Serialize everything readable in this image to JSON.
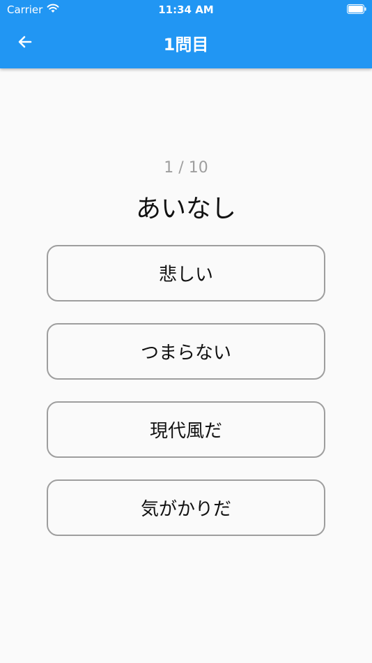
{
  "status_bar": {
    "carrier": "Carrier",
    "time": "11:34 AM"
  },
  "header": {
    "title": "1問目",
    "back_icon": "arrow-left-icon",
    "background_color": "#2196f3"
  },
  "quiz": {
    "counter": "1 / 10",
    "question": "あいなし",
    "answers": [
      {
        "label": "悲しい"
      },
      {
        "label": "つまらない"
      },
      {
        "label": "現代風だ"
      },
      {
        "label": "気がかりだ"
      }
    ]
  }
}
